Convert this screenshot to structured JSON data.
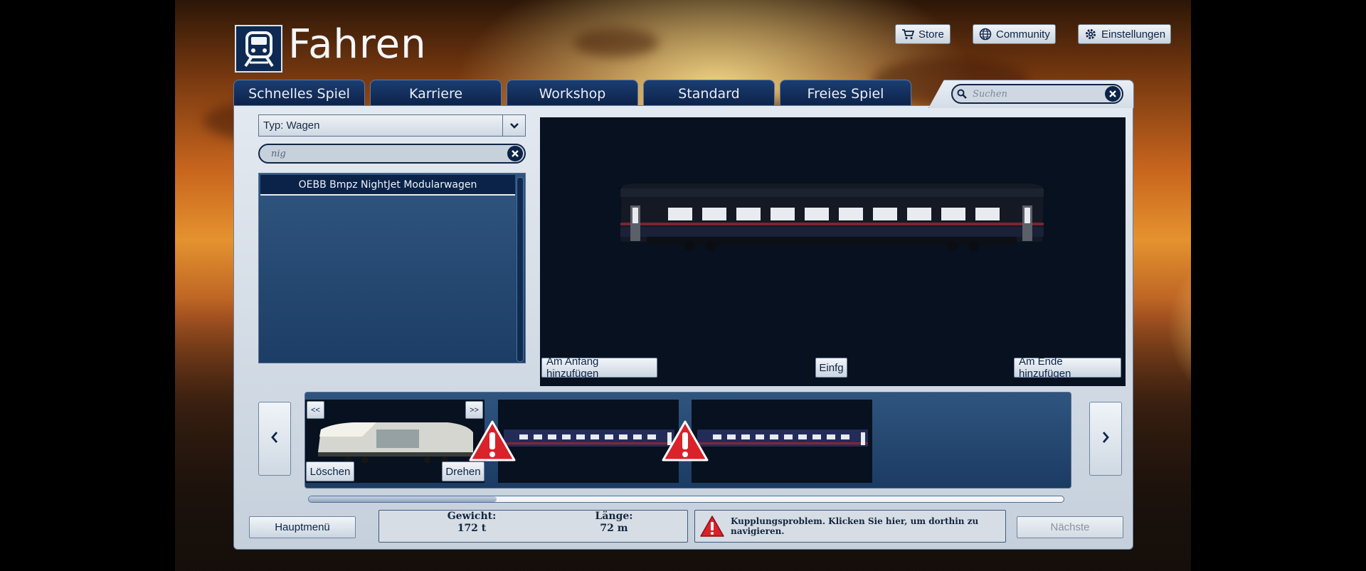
{
  "header": {
    "title": "Fahren",
    "logo_icon": "train-icon"
  },
  "top_buttons": {
    "store": "Store",
    "community": "Community",
    "settings": "Einstellungen"
  },
  "tabs": [
    {
      "label": "Schnelles Spiel"
    },
    {
      "label": "Karriere"
    },
    {
      "label": "Workshop"
    },
    {
      "label": "Standard"
    },
    {
      "label": "Freies Spiel"
    }
  ],
  "search": {
    "placeholder": "Suchen"
  },
  "filter": {
    "type_label": "Typ: Wagen",
    "text_value": "nig"
  },
  "vehicle_list": {
    "items": [
      "OEBB Bmpz NightJet Modularwagen"
    ]
  },
  "preview_actions": {
    "add_start": "Am Anfang hinzufügen",
    "insert": "Einfg",
    "add_end": "Am Ende hinzufügen"
  },
  "consist": {
    "prev_label": "<<",
    "next_label": ">>",
    "delete_label": "Löschen",
    "rotate_label": "Drehen",
    "scroll_position": 0.25
  },
  "bottom": {
    "main_menu": "Hauptmenü",
    "next": "Nächste",
    "weight_label": "Gewicht:",
    "weight_value": "172 t",
    "length_label": "Länge:",
    "length_value": "72 m",
    "message": "Kupplungsproblem. Klicken Sie hier, um dorthin zu navigieren."
  },
  "colors": {
    "accent": "#0e2a52",
    "warning": "#d9222a"
  }
}
